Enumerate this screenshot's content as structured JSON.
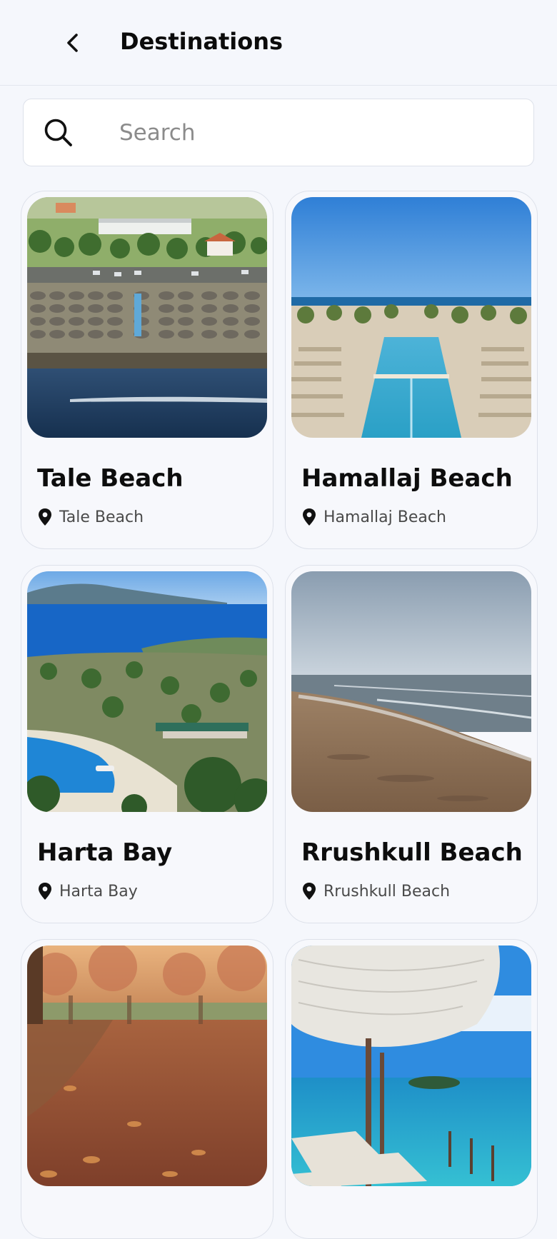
{
  "header": {
    "title": "Destinations",
    "back_icon": "chevron-left-icon"
  },
  "search": {
    "placeholder": "Search",
    "value": "",
    "icon": "search-icon"
  },
  "destinations": [
    {
      "name": "Tale Beach",
      "location": "Tale Beach",
      "image": "tale-beach-photo"
    },
    {
      "name": "Hamallaj Beach",
      "location": "Hamallaj Beach",
      "image": "hamallaj-beach-photo"
    },
    {
      "name": "Harta Bay",
      "location": "Harta Bay",
      "image": "harta-bay-photo"
    },
    {
      "name": "Rrushkull Beach",
      "location": "Rrushkull Beach",
      "image": "rrushkull-beach-photo"
    },
    {
      "name": "",
      "location": "",
      "image": "autumn-park-photo"
    },
    {
      "name": "",
      "location": "",
      "image": "beach-parasols-photo"
    }
  ],
  "colors": {
    "background": "#f5f7fc",
    "card_border": "#dde1ea",
    "title_text": "#0b0b0b",
    "secondary_text": "#4a4a4a",
    "placeholder_text": "#8b8b8b"
  }
}
